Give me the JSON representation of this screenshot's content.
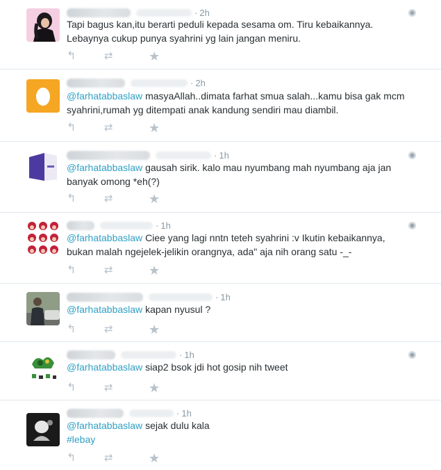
{
  "tweets": [
    {
      "time": "2h",
      "mention": "",
      "text": "Tapi bagus kan,itu berarti peduli kepada sesama om. Tiru kebaikannya. Lebaynya cukup punya syahrini yg lain jangan meniru.",
      "hashtag": "",
      "avatar": "user-photo-1"
    },
    {
      "time": "2h",
      "mention": "@farhatabbaslaw",
      "text": "masyaAllah..dimata farhat smua salah...kamu bisa gak mcm syahrini,rumah yg ditempati anak kandung sendiri mau diambil.",
      "hashtag": "",
      "avatar": "default-egg-avatar"
    },
    {
      "time": "1h",
      "mention": "@farhatabbaslaw",
      "text": "gausah sirik. kalo mau nyumbang mah nyumbang aja jan banyak omong *eh(?)",
      "hashtag": "",
      "avatar": "user-photo-3"
    },
    {
      "time": "1h",
      "mention": "@farhatabbaslaw",
      "text": "Ciee yang lagi nntn teteh syahrini :v Ikutin kebaikannya, bukan malah ngejelek-jelikin orangnya, ada\" aja nih orang satu -_-",
      "hashtag": "",
      "avatar": "user-photo-4"
    },
    {
      "time": "1h",
      "mention": "@farhatabbaslaw",
      "text": "kapan nyusul ?",
      "hashtag": "",
      "avatar": "user-photo-5"
    },
    {
      "time": "1h",
      "mention": "@farhatabbaslaw",
      "text": "siap2 bsok jdi hot gosip nih tweet",
      "hashtag": "",
      "avatar": "user-photo-6"
    },
    {
      "time": "1h",
      "mention": "@farhatabbaslaw",
      "text": "sejak dulu kala",
      "hashtag": "#lebay",
      "avatar": "user-photo-7"
    }
  ],
  "icons": {
    "reply": "reply-icon",
    "retweet": "retweet-icon",
    "favorite": "star-icon",
    "privacy": "globe-icon"
  },
  "colors": {
    "link": "#2fa0c4",
    "text": "#292f33",
    "muted": "#8899a6",
    "divider": "#e1e8ed",
    "egg": "#f5a623"
  }
}
